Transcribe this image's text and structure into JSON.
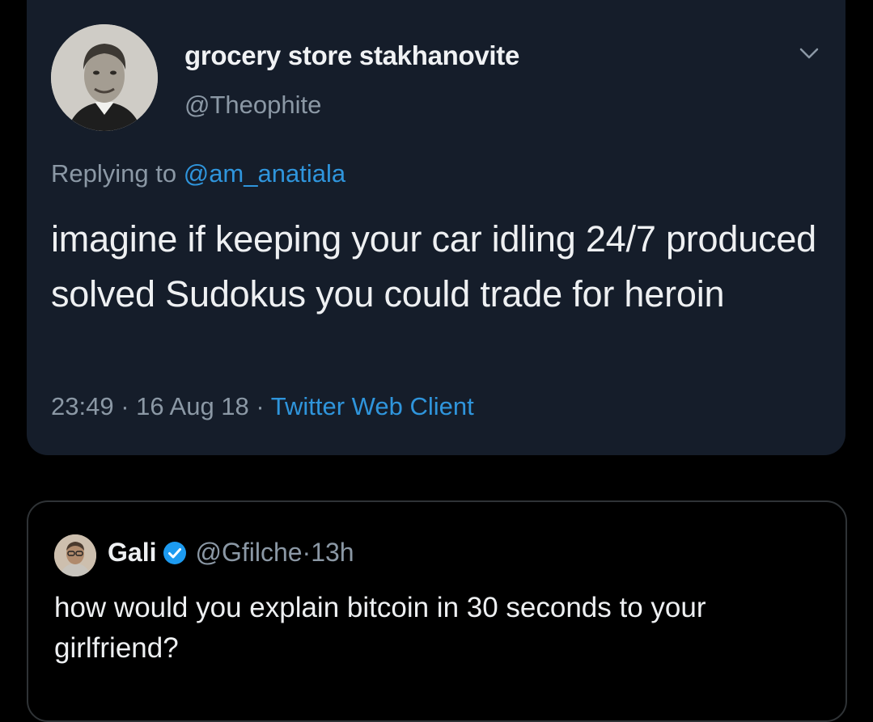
{
  "tweet": {
    "display_name": "grocery store stakhanovite",
    "handle": "@Theophite",
    "replying_prefix": "Replying to ",
    "replying_to": "@am_anatiala",
    "text": "imagine if keeping your car idling 24/7 produced solved Sudokus you could trade for heroin",
    "time": "23:49",
    "date": "16 Aug 18",
    "separator": " · ",
    "client": "Twitter Web Client"
  },
  "quoted_tweet": {
    "display_name": "Gali",
    "handle": "@Gfilche",
    "age": "13h",
    "separator": " · ",
    "text": "how would you explain bitcoin in 30 seconds to your girlfriend?"
  },
  "colors": {
    "card_bg": "#151d2a",
    "link": "#2f95dc",
    "muted": "#8b98a5",
    "verified": "#1d9bf0"
  },
  "icons": {
    "menu": "chevron-down-icon",
    "verified": "verified-badge-icon"
  }
}
